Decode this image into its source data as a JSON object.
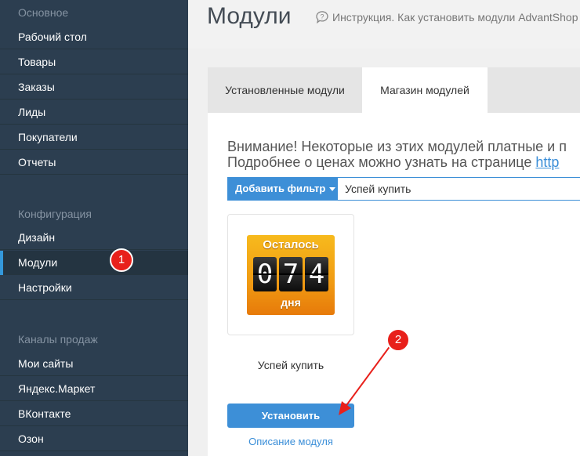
{
  "sidebar": {
    "sections": [
      {
        "title": "Основное",
        "items": [
          "Рабочий стол",
          "Товары",
          "Заказы",
          "Лиды",
          "Покупатели",
          "Отчеты"
        ]
      },
      {
        "title": "Конфигурация",
        "items": [
          "Дизайн",
          "Модули",
          "Настройки"
        ]
      },
      {
        "title": "Каналы продаж",
        "items": [
          "Мои сайты",
          "Яндекс.Маркет",
          "ВКонтакте",
          "Озон"
        ]
      }
    ],
    "active_item": "Модули"
  },
  "header": {
    "title": "Модули",
    "help_text": "Инструкция. Как установить модули AdvantShop"
  },
  "tabs": [
    "Установленные модули",
    "Магазин модулей"
  ],
  "active_tab": "Магазин модулей",
  "notice": {
    "line1": "Внимание! Некоторые из этих модулей платные и п",
    "line2_text": "Подробнее о ценах можно узнать на странице ",
    "line2_link": "http"
  },
  "filter": {
    "button_label": "Добавить фильтр",
    "value": "Успей купить"
  },
  "module": {
    "image_top": "Осталось",
    "digits": [
      "0",
      "7",
      "4"
    ],
    "image_bottom": "дня",
    "name": "Успей купить",
    "install_label": "Установить",
    "description_link": "Описание модуля"
  },
  "badges": [
    "1",
    "2"
  ],
  "colors": {
    "sidebar_bg": "#2c3e50",
    "accent": "#3d8fd7",
    "badge": "#e8201b"
  }
}
